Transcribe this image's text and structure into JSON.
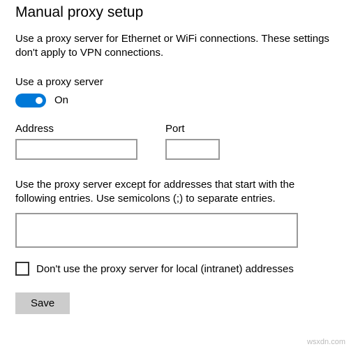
{
  "title": "Manual proxy setup",
  "description": "Use a proxy server for Ethernet or WiFi connections. These settings don't apply to VPN connections.",
  "toggle": {
    "label": "Use a proxy server",
    "state_label": "On",
    "on": true
  },
  "address": {
    "label": "Address",
    "value": ""
  },
  "port": {
    "label": "Port",
    "value": ""
  },
  "exceptions": {
    "description": "Use the proxy server except for addresses that start with the following entries. Use semicolons (;) to separate entries.",
    "value": ""
  },
  "local_bypass": {
    "label": "Don't use the proxy server for local (intranet) addresses",
    "checked": false
  },
  "save_label": "Save",
  "watermark": "wsxdn.com"
}
